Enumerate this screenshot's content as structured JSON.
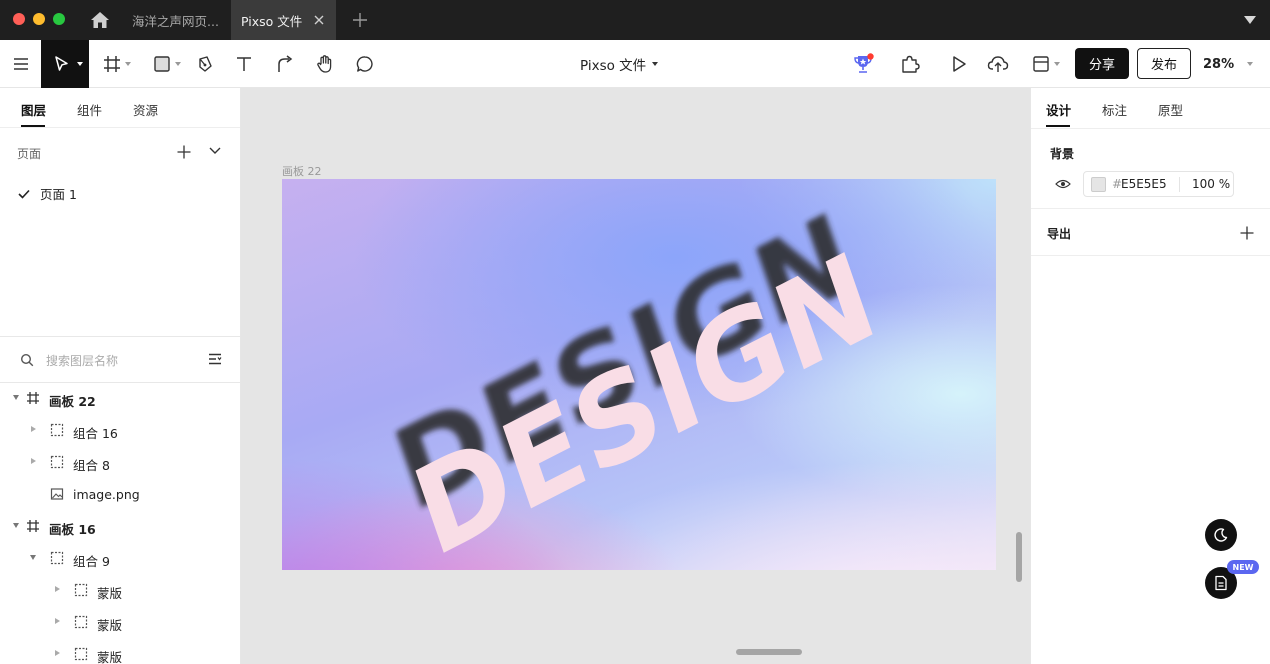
{
  "tabs": {
    "inactive_label": "海洋之声网页...",
    "active_label": "Pixso 文件"
  },
  "toolbar": {
    "file_title": "Pixso 文件",
    "share_label": "分享",
    "publish_label": "发布",
    "zoom": "28%"
  },
  "left_panel": {
    "tabs": [
      "图层",
      "组件",
      "资源"
    ],
    "pages_header": "页面",
    "pages": [
      {
        "label": "页面 1",
        "selected": true
      }
    ],
    "search_placeholder": "搜索图层名称",
    "layers": [
      {
        "name": "画板 22",
        "type": "frame",
        "expanded": true,
        "bold": true
      },
      {
        "name": "组合 16",
        "type": "group",
        "expanded": false
      },
      {
        "name": "组合 8",
        "type": "group",
        "expanded": false
      },
      {
        "name": "image.png",
        "type": "image"
      },
      {
        "name": "画板 16",
        "type": "frame",
        "expanded": true,
        "bold": true
      },
      {
        "name": "组合 9",
        "type": "group",
        "expanded": true
      },
      {
        "name": "蒙版",
        "type": "mask",
        "expanded": false
      },
      {
        "name": "蒙版",
        "type": "mask",
        "expanded": false
      },
      {
        "name": "蒙版",
        "type": "mask",
        "expanded": false
      }
    ]
  },
  "canvas": {
    "frame_label": "画板 22",
    "artwork_text": "DESIGN"
  },
  "right_panel": {
    "tabs": [
      "设计",
      "标注",
      "原型"
    ],
    "background_title": "背景",
    "background_hash": "#",
    "background_hex": "E5E5E5",
    "background_opacity": "100",
    "background_opacity_unit": "%",
    "export_title": "导出",
    "new_badge": "NEW"
  },
  "colors": {
    "accent_dark": "#111111",
    "canvas_bg": "#E5E5E5",
    "badge": "#5B67F0"
  }
}
